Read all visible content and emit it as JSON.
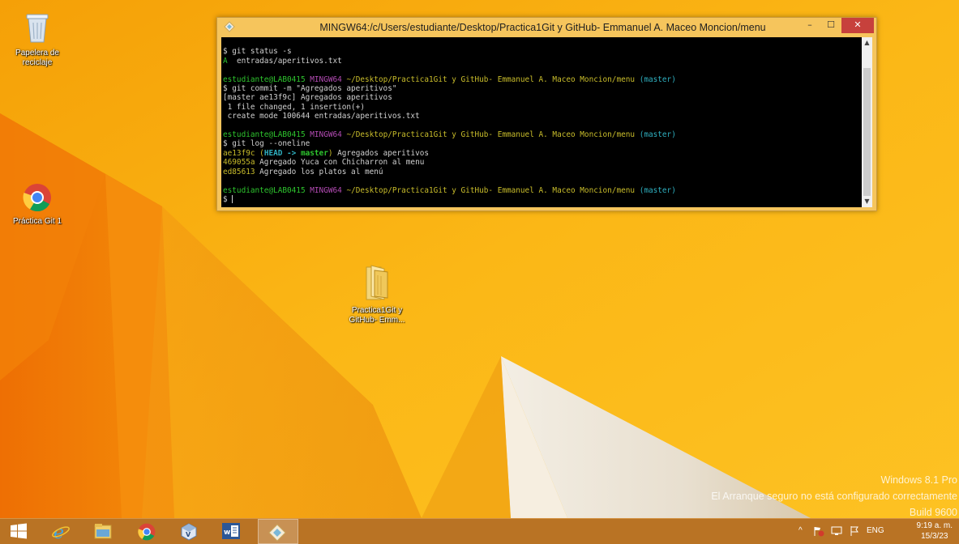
{
  "desktop": {
    "icons": [
      {
        "label_lines": [
          "Papelera de",
          "reciclaje"
        ]
      },
      {
        "label_lines": [
          "Práctica Git 1"
        ]
      },
      {
        "label_lines": [
          "Practica1Git y",
          "GitHub- Emm..."
        ]
      }
    ],
    "watermark": {
      "line1": "Windows 8.1 Pro",
      "line2": "El Arranque seguro no está configurado correctamente",
      "line3": "Build 9600"
    }
  },
  "terminal": {
    "title": "MINGW64:/c/Users/estudiante/Desktop/Practica1Git y GitHub- Emmanuel A. Maceo Moncion/menu",
    "prompt": {
      "user": "estudiante@LAB0415",
      "system": "MINGW64",
      "path": "~/Desktop/Practica1Git y GitHub- Emmanuel A. Maceo Moncion/menu",
      "branch": "(master)"
    },
    "cmd1": "$ git status -s",
    "out1_flag": "A",
    "out1_file": "  entradas/aperitivos.txt",
    "cmd2": "$ git commit -m \"Agregados aperitivos\"",
    "out2": [
      "[master ae13f9c] Agregados aperitivos",
      " 1 file changed, 1 insertion(+)",
      " create mode 100644 entradas/aperitivos.txt"
    ],
    "cmd3": "$ git log --oneline",
    "log": [
      {
        "hash": "ae13f9c",
        "ref_open": " (",
        "head": "HEAD -> ",
        "master": "master",
        "ref_close": ")",
        "msg": " Agregados aperitivos"
      },
      {
        "hash": "469055a",
        "msg": " Agregado Yuca con Chicharron al menu"
      },
      {
        "hash": "ed85613",
        "msg": " Agregado los platos al menú"
      }
    ],
    "prompt_symbol": "$ ",
    "buttons": {
      "minimize": "–",
      "maximize": "☐",
      "close": "✕"
    }
  },
  "taskbar": {
    "tray": {
      "lang": "ENG",
      "chevron": "^"
    },
    "clock": {
      "time": "9:19 a. m.",
      "date": "15/3/23"
    }
  },
  "colors": {
    "wallpaper_light": "#fcc92a",
    "wallpaper_dark": "#f07a05",
    "taskbar": "#b97324",
    "close_button": "#c7413c"
  }
}
